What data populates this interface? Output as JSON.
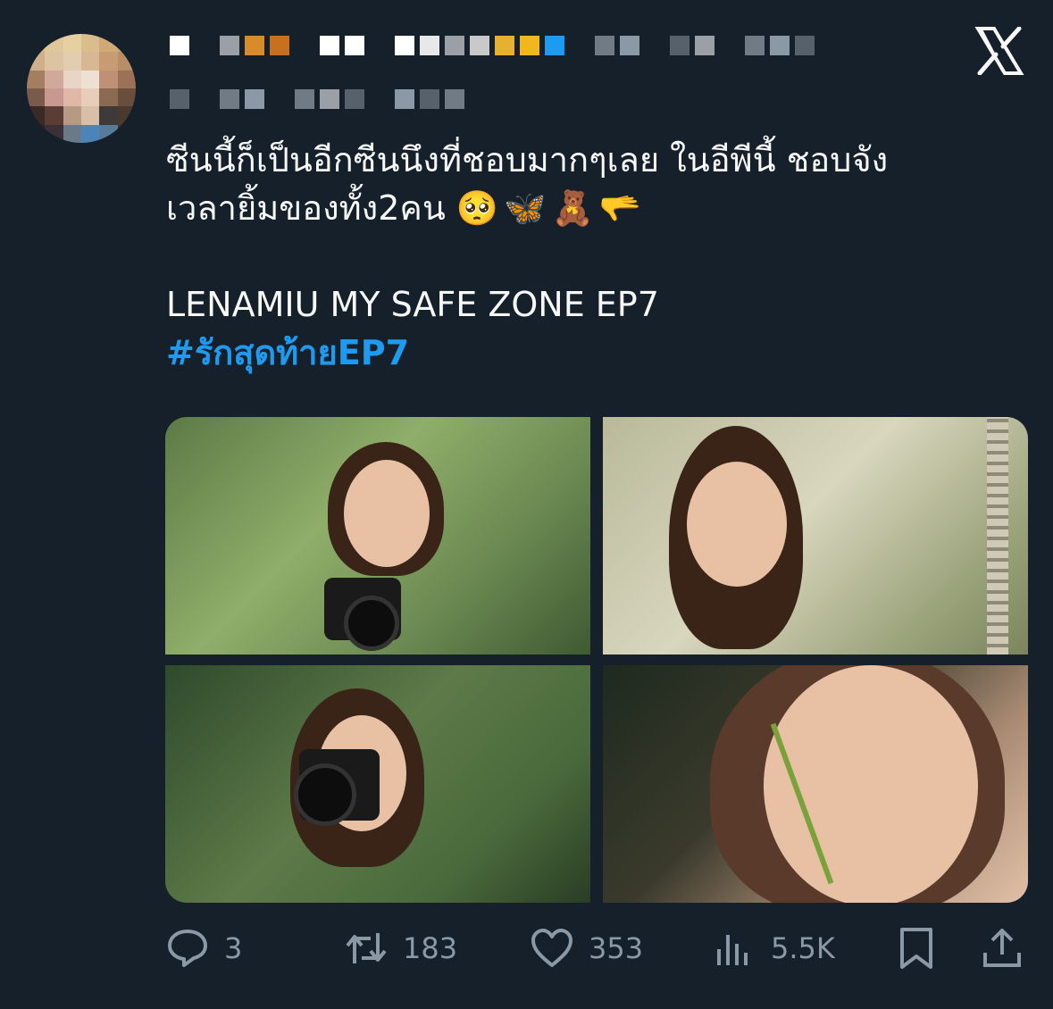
{
  "tweet": {
    "text_line1": "ซีนนี้ก็เป็นอีกซีนนึงที่ชอบมากๆเลย ในอีพีนี้ ชอบจัง",
    "text_line2": "เวลายิ้มของทั้ง2คน",
    "emojis": "🥺🦋🧸🫳",
    "title_line": "LENAMIU MY SAFE ZONE EP7",
    "hashtag": "#รักสุดท้ายEP7"
  },
  "colors": {
    "background": "#15202b",
    "text": "#f7f9f9",
    "muted": "#8b98a5",
    "link": "#1d9bf0"
  },
  "icons": {
    "platform": "x-logo-icon",
    "reply": "reply-icon",
    "retweet": "retweet-icon",
    "like": "heart-icon",
    "views": "views-icon",
    "bookmark": "bookmark-icon",
    "share": "share-icon"
  },
  "actions": {
    "reply_count": "3",
    "retweet_count": "183",
    "like_count": "353",
    "view_count": "5.5K"
  }
}
